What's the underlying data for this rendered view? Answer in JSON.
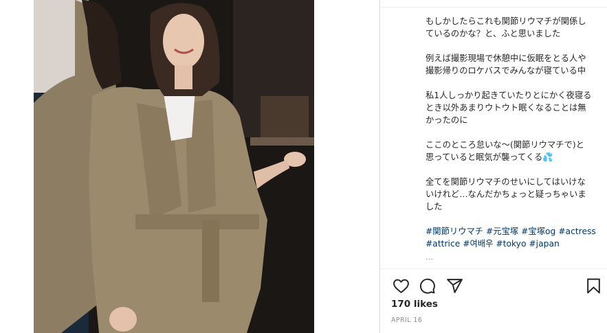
{
  "post": {
    "caption_paragraphs": [
      "もしかしたらこれも関節リウマチが関係し\nているのかな？と、ふと思いました",
      "例えば撮影現場で休憩中に仮眠をとる人や\n撮影帰りのロケバスでみんなが寝ている中",
      "私1人しっかり起きていたりとにかく夜寝る\nとき以外あまりウトウト眠くなることは無\nかったのに",
      "ここのところ怠いな〜(関節リウマチで)と\n思っていると眠気が襲ってくる💦",
      "全てを関節リウマチのせいにしてはいけな\nいけれど…なんだかちょっと疑っちゃいま\nした"
    ],
    "hashtags": "#関節リウマチ #元宝塚 #宝塚og #actress\n#attrice #여배우 #tokyo #japan",
    "truncated_more": "…",
    "likes": "170 likes",
    "date": "APRIL 16"
  },
  "icons": {
    "like": "heart-icon",
    "comment": "comment-icon",
    "share": "send-icon",
    "save": "bookmark-icon"
  },
  "colors": {
    "text": "#262626",
    "hashtag": "#00376b",
    "secondary": "#8e8e8e",
    "divider": "#dbdbdb"
  }
}
